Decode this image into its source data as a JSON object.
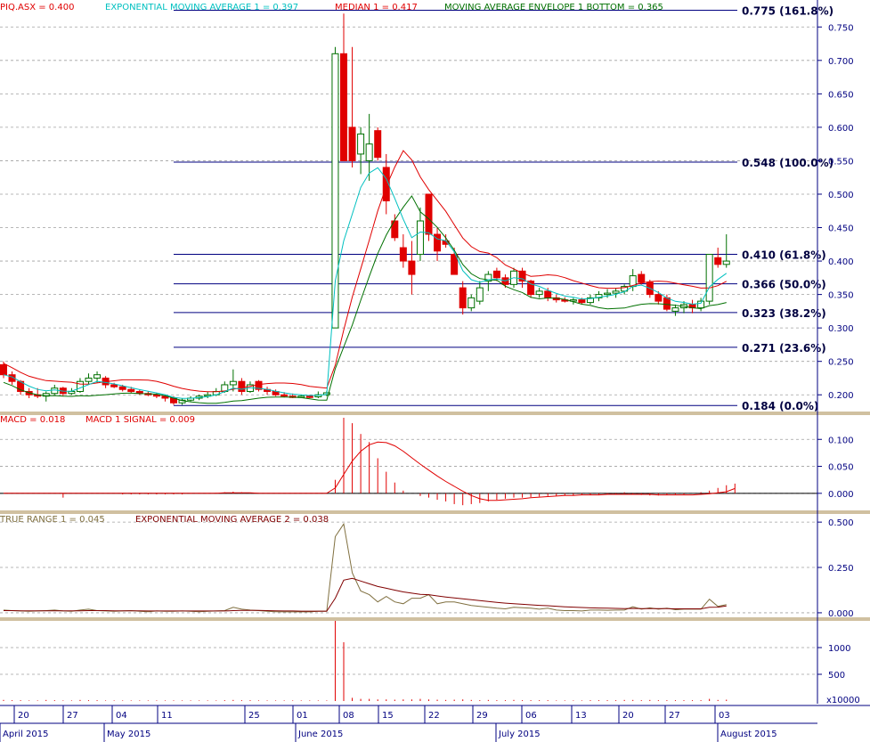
{
  "chart_data": [
    {
      "type": "candlestick",
      "panel": "price",
      "legend": [
        {
          "text": "PIQ.ASX = 0.400",
          "color": "#e00000"
        },
        {
          "text": "EXPONENTIAL MOVING AVERAGE 1 = 0.397",
          "color": "#00c0c0"
        },
        {
          "text": "MEDIAN 1 = 0.417",
          "color": "#e00000"
        },
        {
          "text": "MOVING AVERAGE ENVELOPE 1 BOTTOM = 0.365",
          "color": "#007000"
        }
      ],
      "y_ticks": [
        "0.750",
        "0.700",
        "0.650",
        "0.600",
        "0.550",
        "0.500",
        "0.450",
        "0.400",
        "0.350",
        "0.300",
        "0.250",
        "0.200"
      ],
      "ylim": [
        0.175,
        0.785
      ],
      "fib_levels": [
        {
          "value": 0.775,
          "label": "0.775 (161.8%)"
        },
        {
          "value": 0.548,
          "label": "0.548 (100.0%)"
        },
        {
          "value": 0.41,
          "label": "0.410 (61.8%)"
        },
        {
          "value": 0.366,
          "label": "0.366 (50.0%)"
        },
        {
          "value": 0.323,
          "label": "0.323 (38.2%)"
        },
        {
          "value": 0.271,
          "label": "0.271 (23.6%)"
        },
        {
          "value": 0.184,
          "label": "0.184 (0.0%)"
        }
      ],
      "candles": [
        [
          0.245,
          0.25,
          0.225,
          0.23
        ],
        [
          0.23,
          0.235,
          0.215,
          0.22
        ],
        [
          0.22,
          0.222,
          0.2,
          0.205
        ],
        [
          0.205,
          0.21,
          0.195,
          0.2
        ],
        [
          0.2,
          0.21,
          0.195,
          0.198
        ],
        [
          0.198,
          0.205,
          0.19,
          0.202
        ],
        [
          0.202,
          0.215,
          0.2,
          0.21
        ],
        [
          0.21,
          0.212,
          0.198,
          0.202
        ],
        [
          0.202,
          0.21,
          0.2,
          0.205
        ],
        [
          0.205,
          0.225,
          0.203,
          0.22
        ],
        [
          0.22,
          0.232,
          0.215,
          0.225
        ],
        [
          0.225,
          0.235,
          0.218,
          0.23
        ],
        [
          0.225,
          0.228,
          0.21,
          0.215
        ],
        [
          0.215,
          0.218,
          0.21,
          0.212
        ],
        [
          0.212,
          0.215,
          0.205,
          0.208
        ],
        [
          0.208,
          0.212,
          0.203,
          0.205
        ],
        [
          0.205,
          0.208,
          0.2,
          0.202
        ],
        [
          0.202,
          0.205,
          0.198,
          0.2
        ],
        [
          0.2,
          0.203,
          0.195,
          0.198
        ],
        [
          0.198,
          0.2,
          0.19,
          0.195
        ],
        [
          0.195,
          0.198,
          0.185,
          0.188
        ],
        [
          0.188,
          0.195,
          0.185,
          0.192
        ],
        [
          0.192,
          0.198,
          0.19,
          0.195
        ],
        [
          0.195,
          0.2,
          0.192,
          0.198
        ],
        [
          0.198,
          0.205,
          0.195,
          0.2
        ],
        [
          0.2,
          0.21,
          0.198,
          0.205
        ],
        [
          0.205,
          0.22,
          0.203,
          0.215
        ],
        [
          0.215,
          0.238,
          0.205,
          0.22
        ],
        [
          0.22,
          0.225,
          0.2,
          0.205
        ],
        [
          0.205,
          0.22,
          0.203,
          0.215
        ],
        [
          0.22,
          0.222,
          0.205,
          0.208
        ],
        [
          0.208,
          0.212,
          0.2,
          0.205
        ],
        [
          0.205,
          0.208,
          0.198,
          0.2
        ],
        [
          0.2,
          0.204,
          0.196,
          0.198
        ],
        [
          0.198,
          0.202,
          0.195,
          0.197
        ],
        [
          0.197,
          0.2,
          0.195,
          0.198
        ],
        [
          0.198,
          0.2,
          0.195,
          0.197
        ],
        [
          0.197,
          0.205,
          0.195,
          0.2
        ],
        [
          0.2,
          0.206,
          0.198,
          0.203
        ],
        [
          0.3,
          0.72,
          0.3,
          0.71
        ],
        [
          0.71,
          0.77,
          0.55,
          0.55
        ],
        [
          0.6,
          0.72,
          0.54,
          0.55
        ],
        [
          0.56,
          0.6,
          0.53,
          0.59
        ],
        [
          0.55,
          0.62,
          0.52,
          0.575
        ],
        [
          0.595,
          0.6,
          0.55,
          0.555
        ],
        [
          0.54,
          0.56,
          0.47,
          0.49
        ],
        [
          0.46,
          0.47,
          0.43,
          0.435
        ],
        [
          0.42,
          0.44,
          0.39,
          0.4
        ],
        [
          0.4,
          0.43,
          0.35,
          0.38
        ],
        [
          0.41,
          0.48,
          0.4,
          0.46
        ],
        [
          0.5,
          0.5,
          0.43,
          0.44
        ],
        [
          0.44,
          0.45,
          0.4,
          0.415
        ],
        [
          0.43,
          0.44,
          0.42,
          0.425
        ],
        [
          0.41,
          0.42,
          0.38,
          0.38
        ],
        [
          0.36,
          0.37,
          0.32,
          0.33
        ],
        [
          0.33,
          0.35,
          0.325,
          0.345
        ],
        [
          0.34,
          0.37,
          0.335,
          0.36
        ],
        [
          0.37,
          0.385,
          0.355,
          0.38
        ],
        [
          0.385,
          0.39,
          0.37,
          0.375
        ],
        [
          0.375,
          0.38,
          0.36,
          0.365
        ],
        [
          0.365,
          0.39,
          0.36,
          0.385
        ],
        [
          0.385,
          0.39,
          0.36,
          0.37
        ],
        [
          0.37,
          0.372,
          0.345,
          0.35
        ],
        [
          0.35,
          0.36,
          0.345,
          0.355
        ],
        [
          0.355,
          0.36,
          0.34,
          0.345
        ],
        [
          0.345,
          0.35,
          0.338,
          0.342
        ],
        [
          0.342,
          0.346,
          0.338,
          0.34
        ],
        [
          0.34,
          0.345,
          0.335,
          0.342
        ],
        [
          0.342,
          0.345,
          0.335,
          0.338
        ],
        [
          0.338,
          0.35,
          0.335,
          0.345
        ],
        [
          0.345,
          0.355,
          0.34,
          0.35
        ],
        [
          0.35,
          0.358,
          0.345,
          0.352
        ],
        [
          0.352,
          0.36,
          0.345,
          0.355
        ],
        [
          0.355,
          0.365,
          0.35,
          0.362
        ],
        [
          0.362,
          0.388,
          0.355,
          0.378
        ],
        [
          0.38,
          0.385,
          0.365,
          0.368
        ],
        [
          0.368,
          0.372,
          0.345,
          0.35
        ],
        [
          0.35,
          0.355,
          0.335,
          0.34
        ],
        [
          0.345,
          0.35,
          0.325,
          0.328
        ],
        [
          0.325,
          0.335,
          0.318,
          0.33
        ],
        [
          0.33,
          0.34,
          0.322,
          0.335
        ],
        [
          0.335,
          0.342,
          0.322,
          0.33
        ],
        [
          0.33,
          0.345,
          0.325,
          0.34
        ],
        [
          0.34,
          0.41,
          0.335,
          0.41
        ],
        [
          0.405,
          0.42,
          0.39,
          0.395
        ],
        [
          0.395,
          0.44,
          0.39,
          0.4
        ]
      ]
    },
    {
      "type": "line",
      "panel": "macd",
      "legend": [
        {
          "text": "MACD = 0.018",
          "color": "#e00000"
        },
        {
          "text": "MACD 1 SIGNAL = 0.009",
          "color": "#e00000"
        }
      ],
      "y_ticks": [
        "0.100",
        "0.050",
        "0.000"
      ],
      "ylim": [
        -0.03,
        0.145
      ],
      "signal": [
        0.0,
        0.0,
        0.0,
        0.0,
        0.0,
        0.0,
        0.0,
        0.0,
        0.0,
        0.0,
        0.0,
        0.0,
        0.0,
        0.0,
        0.0,
        0.0,
        0.0,
        0.0,
        0.0,
        0.0,
        0.0,
        0.0,
        0.0,
        0.0,
        0.0,
        0.0,
        0.001,
        0.001,
        0.001,
        0.001,
        0.0,
        0.0,
        0.0,
        0.0,
        0.0,
        0.0,
        0.0,
        0.0,
        0.0,
        0.01,
        0.035,
        0.06,
        0.078,
        0.09,
        0.095,
        0.094,
        0.088,
        0.078,
        0.066,
        0.054,
        0.043,
        0.032,
        0.022,
        0.013,
        0.004,
        -0.004,
        -0.01,
        -0.013,
        -0.013,
        -0.012,
        -0.011,
        -0.01,
        -0.008,
        -0.007,
        -0.006,
        -0.005,
        -0.004,
        -0.004,
        -0.003,
        -0.003,
        -0.003,
        -0.002,
        -0.002,
        -0.002,
        -0.002,
        -0.002,
        -0.002,
        -0.003,
        -0.003,
        -0.003,
        -0.003,
        -0.003,
        -0.002,
        -0.001,
        0.001,
        0.003,
        0.009
      ],
      "histogram": [
        0,
        0,
        0,
        0,
        0,
        0,
        0,
        -0.008,
        0,
        0,
        0,
        0,
        0,
        0,
        -0.002,
        -0.002,
        -0.002,
        -0.002,
        -0.002,
        -0.002,
        -0.002,
        -0.002,
        -0.001,
        -0.001,
        -0.001,
        0.001,
        0.002,
        0.003,
        0.002,
        0.001,
        0,
        0,
        0,
        0,
        0,
        0,
        0,
        0,
        0,
        0.025,
        0.14,
        0.13,
        0.11,
        0.095,
        0.065,
        0.04,
        0.02,
        0.005,
        0,
        -0.005,
        -0.008,
        -0.012,
        -0.015,
        -0.02,
        -0.022,
        -0.02,
        -0.018,
        -0.015,
        -0.012,
        -0.01,
        -0.008,
        -0.008,
        -0.007,
        -0.006,
        -0.005,
        -0.005,
        -0.004,
        -0.004,
        -0.003,
        -0.003,
        -0.003,
        -0.002,
        -0.002,
        0.002,
        -0.002,
        -0.003,
        -0.004,
        -0.004,
        -0.003,
        -0.002,
        -0.002,
        0,
        0.002,
        0.005,
        0.01,
        0.015,
        0.018
      ]
    },
    {
      "type": "line",
      "panel": "true_range",
      "legend": [
        {
          "text": "TRUE RANGE 1 = 0.045",
          "color": "#807040"
        },
        {
          "text": "EXPONENTIAL MOVING AVERAGE 2 = 0.038",
          "color": "#800000"
        }
      ],
      "y_ticks": [
        "0.500",
        "0.250",
        "0.000"
      ],
      "ylim": [
        -0.02,
        0.54
      ],
      "true_range": [
        0.015,
        0.012,
        0.01,
        0.008,
        0.01,
        0.012,
        0.015,
        0.01,
        0.008,
        0.015,
        0.02,
        0.012,
        0.01,
        0.008,
        0.01,
        0.012,
        0.008,
        0.006,
        0.01,
        0.008,
        0.008,
        0.01,
        0.008,
        0.006,
        0.008,
        0.01,
        0.012,
        0.03,
        0.02,
        0.015,
        0.012,
        0.008,
        0.006,
        0.005,
        0.005,
        0.005,
        0.005,
        0.008,
        0.008,
        0.42,
        0.49,
        0.22,
        0.12,
        0.1,
        0.06,
        0.09,
        0.06,
        0.05,
        0.08,
        0.08,
        0.1,
        0.05,
        0.06,
        0.06,
        0.05,
        0.04,
        0.035,
        0.03,
        0.025,
        0.022,
        0.03,
        0.028,
        0.025,
        0.02,
        0.025,
        0.015,
        0.012,
        0.012,
        0.01,
        0.015,
        0.015,
        0.014,
        0.015,
        0.015,
        0.033,
        0.02,
        0.027,
        0.02,
        0.025,
        0.017,
        0.02,
        0.02,
        0.02,
        0.075,
        0.035,
        0.045
      ],
      "ema": [
        0.012,
        0.012,
        0.011,
        0.011,
        0.011,
        0.011,
        0.011,
        0.011,
        0.011,
        0.011,
        0.012,
        0.012,
        0.012,
        0.011,
        0.011,
        0.011,
        0.011,
        0.01,
        0.01,
        0.01,
        0.01,
        0.01,
        0.01,
        0.01,
        0.01,
        0.01,
        0.01,
        0.012,
        0.013,
        0.013,
        0.013,
        0.012,
        0.011,
        0.01,
        0.01,
        0.009,
        0.009,
        0.009,
        0.009,
        0.08,
        0.18,
        0.19,
        0.175,
        0.16,
        0.145,
        0.135,
        0.125,
        0.115,
        0.108,
        0.102,
        0.1,
        0.093,
        0.087,
        0.082,
        0.077,
        0.072,
        0.067,
        0.062,
        0.057,
        0.053,
        0.05,
        0.047,
        0.044,
        0.041,
        0.039,
        0.036,
        0.033,
        0.031,
        0.029,
        0.027,
        0.026,
        0.025,
        0.024,
        0.023,
        0.024,
        0.023,
        0.023,
        0.023,
        0.023,
        0.022,
        0.022,
        0.022,
        0.022,
        0.03,
        0.031,
        0.038
      ]
    },
    {
      "type": "bar",
      "panel": "volume",
      "y_ticks": [
        "1000",
        "500"
      ],
      "unit_label": "x10000",
      "ylim": [
        0,
        1500
      ],
      "values": [
        20,
        15,
        15,
        10,
        10,
        20,
        15,
        10,
        10,
        20,
        15,
        15,
        10,
        10,
        10,
        10,
        10,
        10,
        10,
        10,
        10,
        10,
        10,
        10,
        10,
        10,
        15,
        20,
        15,
        15,
        10,
        10,
        10,
        10,
        10,
        10,
        10,
        10,
        10,
        1500,
        1100,
        60,
        40,
        40,
        30,
        30,
        25,
        30,
        30,
        40,
        30,
        25,
        20,
        25,
        30,
        20,
        15,
        20,
        15,
        15,
        20,
        15,
        15,
        15,
        15,
        10,
        10,
        10,
        10,
        15,
        15,
        15,
        15,
        20,
        20,
        15,
        20,
        15,
        15,
        15,
        15,
        15,
        15,
        40,
        20,
        25
      ]
    }
  ],
  "x_axis": {
    "day_labels": [
      "20",
      "27",
      "04",
      "11",
      "25",
      "01",
      "08",
      "15",
      "22",
      "29",
      "06",
      "13",
      "20",
      "27",
      "03"
    ],
    "month_labels": [
      "April 2015",
      "May 2015",
      "June 2015",
      "July 2015",
      "August 2015"
    ]
  }
}
